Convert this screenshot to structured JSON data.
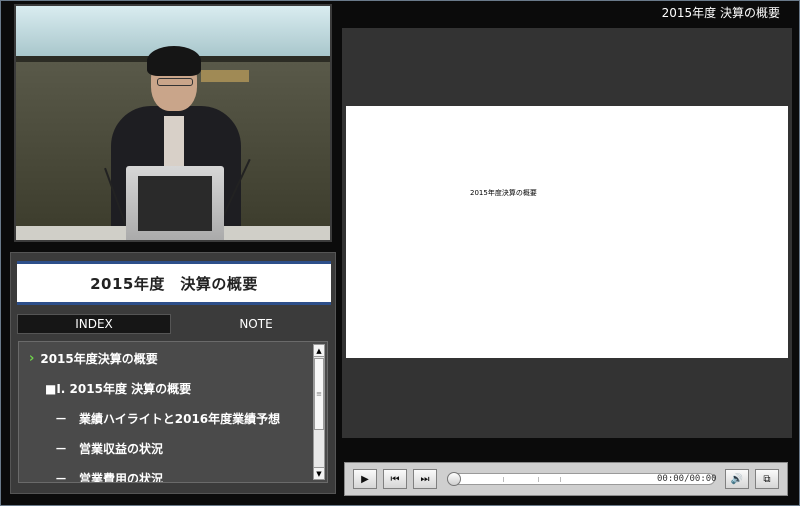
{
  "header": {
    "title": "2015年度 決算の概要"
  },
  "presentation": {
    "title": "2015年度　決算の概要",
    "tabs": [
      {
        "label": "INDEX",
        "active": true
      },
      {
        "label": "NOTE",
        "active": false
      }
    ],
    "index_items": [
      {
        "label": "2015年度決算の概要",
        "level": 0,
        "selected": true
      },
      {
        "label": "■I. 2015年度 決算の概要",
        "level": 1
      },
      {
        "label": "－　業績ハイライトと2016年度業績予想",
        "level": 2
      },
      {
        "label": "－　営業収益の状況",
        "level": 2
      },
      {
        "label": "－　営業費用の状況",
        "level": 2
      }
    ]
  },
  "slide": {
    "text": "2015年度決算の概要"
  },
  "player": {
    "time": "00:00/00:00",
    "icons": [
      "play-icon",
      "previous-icon",
      "next-icon",
      "volume-icon",
      "popout-icon"
    ],
    "progress": 0
  },
  "colors": {
    "accent": "#2d4f8a",
    "chevron": "#6fd34a",
    "background": "#0b0b0b"
  }
}
